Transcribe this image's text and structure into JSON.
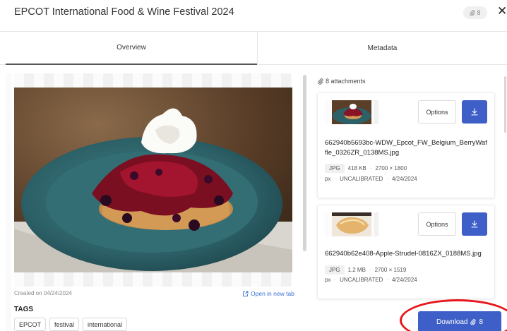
{
  "header": {
    "title": "EPCOT International Food & Wine Festival 2024",
    "attachment_badge": "8",
    "close_symbol": "✕"
  },
  "tabs": [
    {
      "label": "Overview",
      "active": true
    },
    {
      "label": "Metadata",
      "active": false
    }
  ],
  "preview": {
    "created": "Created on 04/24/2024",
    "open_new_tab": "Open in new tab"
  },
  "tags": {
    "title": "TAGS",
    "items": [
      "EPCOT",
      "festival",
      "international"
    ]
  },
  "attachments": {
    "count_label": "8 attachments",
    "items": [
      {
        "filename": "662940b5693bc-WDW_Epcot_FW_Belgium_BerryWaffle_0326ZR_0138MS.jpg",
        "type": "JPG",
        "size": "418 KB",
        "dimensions": "2700 × 1800",
        "unit": "px",
        "calibration": "UNCALIBRATED",
        "date": "4/24/2024",
        "options_label": "Options"
      },
      {
        "filename": "662940b62e408-Apple-Strudel-0816ZX_0188MS.jpg",
        "type": "JPG",
        "size": "1.2 MB",
        "dimensions": "2700 × 1519",
        "unit": "px",
        "calibration": "UNCALIBRATED",
        "date": "4/24/2024",
        "options_label": "Options"
      }
    ]
  },
  "download_all": {
    "label": "Download",
    "count": "8"
  },
  "colors": {
    "accent": "#3e5fc7",
    "highlight": "#e8151b"
  }
}
